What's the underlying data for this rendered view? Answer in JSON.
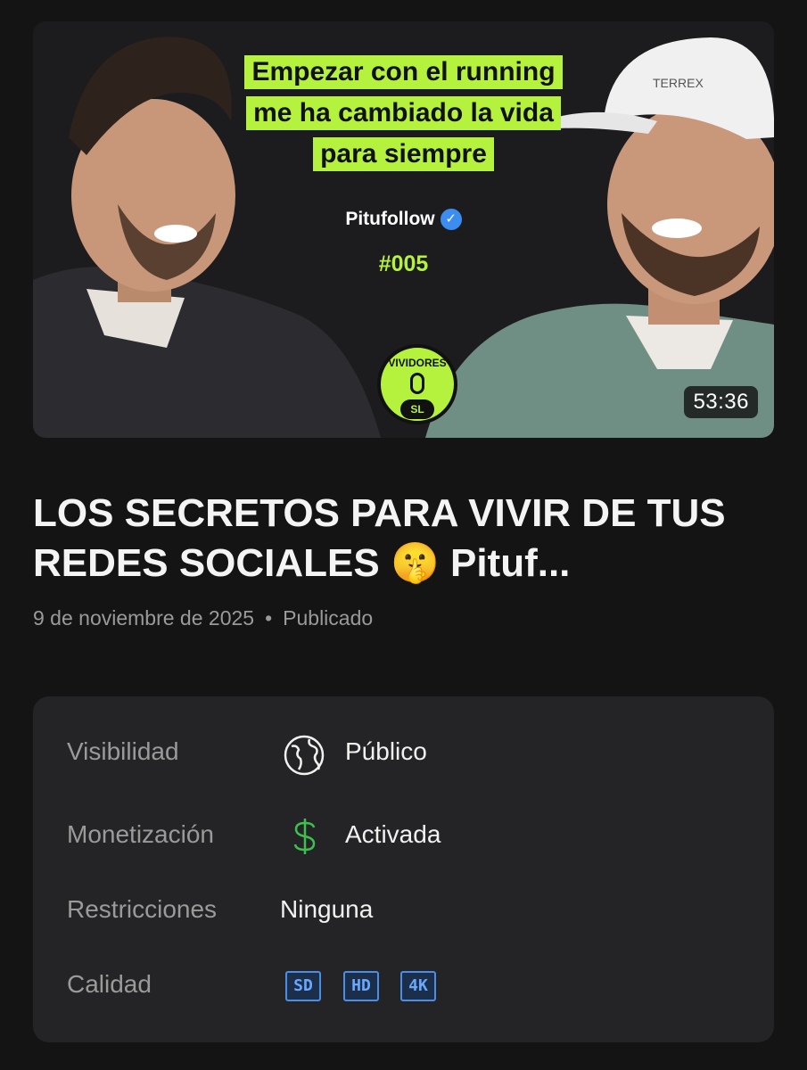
{
  "video": {
    "thumbnail": {
      "headline_lines": [
        "Empezar con el running",
        "me ha cambiado la vida",
        "para siempre"
      ],
      "channel": "Pitufollow",
      "episode": "#005",
      "logo_top": "VIVIDORES",
      "logo_bottom": "SL",
      "cap_text": "TERREX",
      "accent_color": "#b5f23d",
      "verified_color": "#3b8df0"
    },
    "duration": "53:36",
    "title": "LOS SECRETOS PARA VIVIR DE TUS REDES SOCIALES 🤫 Pituf...",
    "date": "9 de noviembre de 2025",
    "status": "Publicado"
  },
  "details": {
    "visibility": {
      "label": "Visibilidad",
      "value": "Público",
      "icon": "globe-icon"
    },
    "monetization": {
      "label": "Monetización",
      "value": "Activada",
      "icon": "dollar-icon",
      "icon_color": "#3fbf4f"
    },
    "restrictions": {
      "label": "Restricciones",
      "value": "Ninguna"
    },
    "quality": {
      "label": "Calidad",
      "badges": [
        "SD",
        "HD",
        "4K"
      ],
      "badge_color": "#4a8ee8"
    }
  }
}
